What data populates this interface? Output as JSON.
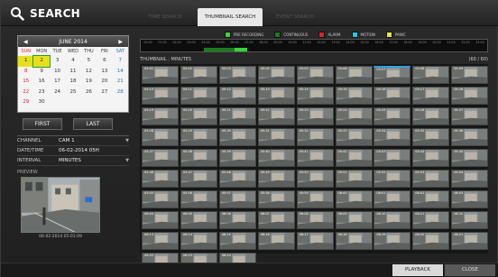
{
  "header": {
    "title": "SEARCH",
    "tabs": [
      {
        "label": "TIME SEARCH",
        "active": false
      },
      {
        "label": "THUMBNAIL SEARCH",
        "active": true
      },
      {
        "label": "EVENT SEARCH",
        "active": false
      }
    ]
  },
  "calendar": {
    "month": "JUNE 2014",
    "weekdays": [
      "SUN",
      "MON",
      "TUE",
      "WED",
      "THU",
      "FRI",
      "SAT"
    ],
    "weeks": [
      [
        "1",
        "2",
        "3",
        "4",
        "5",
        "6",
        "7"
      ],
      [
        "8",
        "9",
        "10",
        "11",
        "12",
        "13",
        "14"
      ],
      [
        "15",
        "16",
        "17",
        "18",
        "19",
        "20",
        "21"
      ],
      [
        "22",
        "23",
        "24",
        "25",
        "26",
        "27",
        "28"
      ],
      [
        "29",
        "30",
        "",
        "",
        "",
        "",
        ""
      ]
    ],
    "recorded_days": [
      "1",
      "2"
    ],
    "selected_day": "2"
  },
  "buttons": {
    "first": "FIRST",
    "last": "LAST",
    "playback": "PLAYBACK",
    "close": "CLOSE"
  },
  "fields": [
    {
      "label": "CHANNEL",
      "value": "CAM 1",
      "dropdown": true
    },
    {
      "label": "DATE/TIME",
      "value": "06-02-2014 05H",
      "dropdown": false
    },
    {
      "label": "INTERVAL",
      "value": "MINUTES",
      "dropdown": true
    }
  ],
  "preview": {
    "label": "PREVIEW",
    "timestamp": "06-02-2014 05:01:09"
  },
  "legend": [
    {
      "label": "PRE RECORDING",
      "color": "#37d437"
    },
    {
      "label": "CONTINUOUS",
      "color": "#1f7a1f"
    },
    {
      "label": "ALARM",
      "color": "#e02020"
    },
    {
      "label": "MOTION",
      "color": "#1ec8e6"
    },
    {
      "label": "PANIC",
      "color": "#ece43a"
    }
  ],
  "timeline_hours": [
    "00:00",
    "01:00",
    "02:00",
    "03:00",
    "04:00",
    "05:00",
    "06:00",
    "07:00",
    "08:00",
    "09:00",
    "10:00",
    "11:00",
    "12:00",
    "13:00",
    "14:00",
    "15:00",
    "16:00",
    "17:00",
    "18:00",
    "19:00",
    "20:00",
    "21:00",
    "22:00",
    "23:00"
  ],
  "thumbnails": {
    "label": "THUMBNAIL : MINUTES",
    "count": "(60 / 60)",
    "timestamps": [
      "05:01",
      "05:02",
      "05:03",
      "05:04",
      "05:05",
      "05:06",
      "05:07",
      "05:08",
      "05:09",
      "05:10",
      "05:11",
      "05:12",
      "05:13",
      "05:14",
      "05:15",
      "05:16",
      "05:17",
      "05:18",
      "05:19",
      "05:20",
      "05:21",
      "05:22",
      "05:23",
      "05:24",
      "05:25",
      "05:26",
      "05:27",
      "05:28",
      "05:29",
      "05:30",
      "05:31",
      "05:32",
      "05:33",
      "05:34",
      "05:35",
      "05:36",
      "05:37",
      "05:38",
      "05:39",
      "05:40",
      "05:41",
      "05:42",
      "05:43",
      "05:44",
      "05:45",
      "05:46",
      "05:47",
      "05:48",
      "05:49",
      "05:50",
      "05:51",
      "05:52",
      "05:53",
      "05:54",
      "05:55",
      "05:56",
      "05:57",
      "05:58",
      "05:59",
      "06:00",
      "06:01",
      "06:02",
      "06:03",
      "06:04",
      "06:05",
      "06:06",
      "06:07",
      "06:08",
      "06:09",
      "06:10",
      "06:11",
      "06:12",
      "06:13",
      "06:14",
      "06:15",
      "06:16",
      "06:17",
      "06:18",
      "06:19",
      "06:20",
      "06:21",
      "06:22",
      "06:23",
      "06:24"
    ],
    "selected_index": 6
  }
}
